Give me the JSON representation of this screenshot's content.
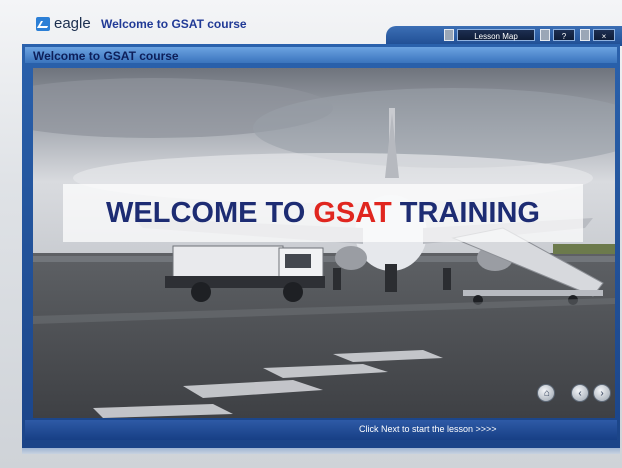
{
  "app": {
    "logo_text": "eagle",
    "course_title": "Welcome to GSAT course"
  },
  "controls": {
    "lesson_map_label": "Lesson Map",
    "help_label": "?",
    "close_label": "×"
  },
  "content": {
    "header_title": "Welcome to GSAT course",
    "banner_prefix": "WELCOME TO ",
    "banner_accent": "GSAT",
    "banner_suffix": " TRAINING",
    "footer_hint": "Click Next to start the lesson >>>>"
  },
  "navigation": {
    "home_icon": "home-icon",
    "back_icon": "back-arrow-icon",
    "next_icon": "next-arrow-icon"
  },
  "colors": {
    "accent_blue": "#213a96",
    "banner_accent": "#e0261f",
    "frame_blue": "#1b4488"
  }
}
